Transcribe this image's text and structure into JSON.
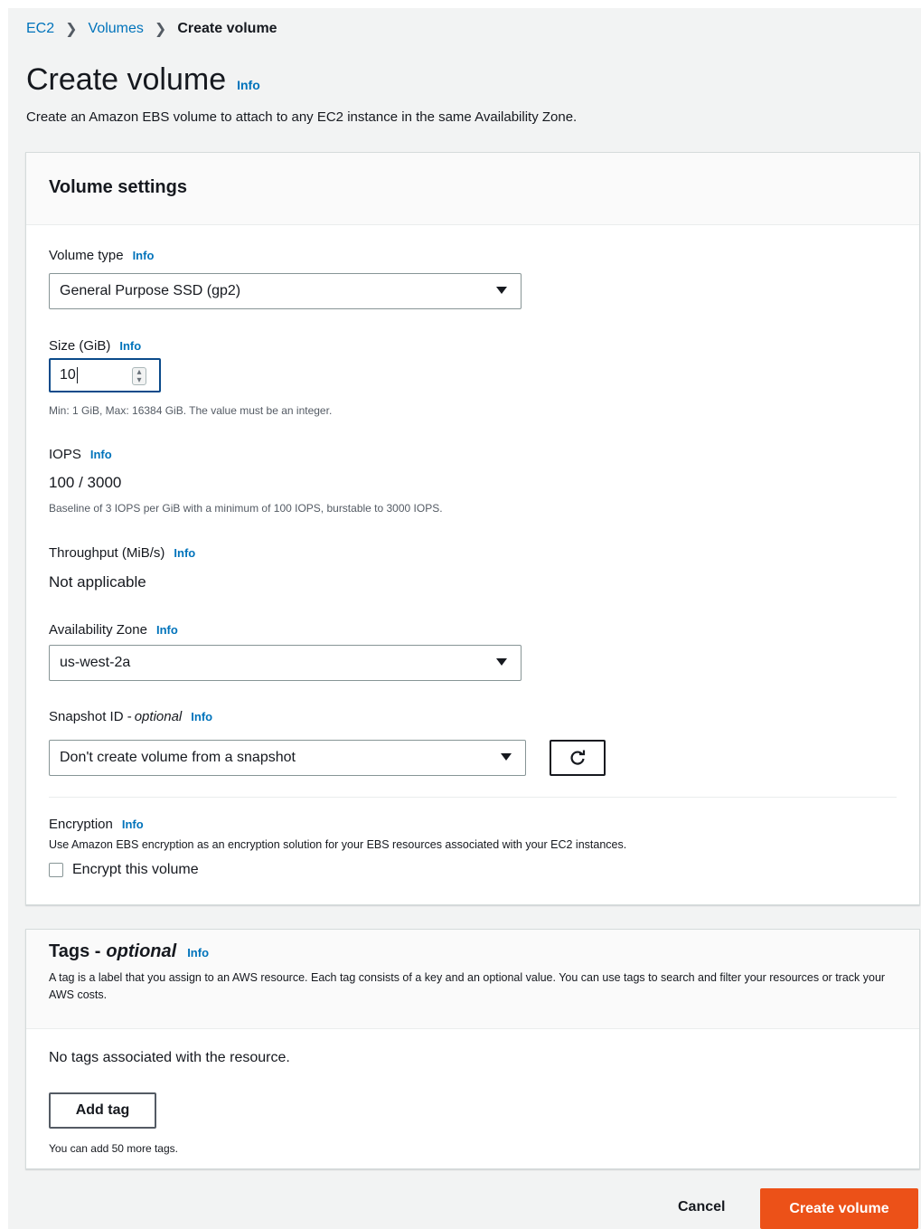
{
  "breadcrumb": {
    "items": [
      "EC2",
      "Volumes",
      "Create volume"
    ]
  },
  "page": {
    "title": "Create volume",
    "info": "Info",
    "description": "Create an Amazon EBS volume to attach to any EC2 instance in the same Availability Zone."
  },
  "volume_settings": {
    "heading": "Volume settings",
    "volume_type": {
      "label": "Volume type",
      "info": "Info",
      "value": "General Purpose SSD (gp2)"
    },
    "size": {
      "label": "Size (GiB)",
      "info": "Info",
      "value": "10",
      "hint": "Min: 1 GiB, Max: 16384 GiB. The value must be an integer."
    },
    "iops": {
      "label": "IOPS",
      "info": "Info",
      "value": "100 / 3000",
      "hint": "Baseline of 3 IOPS per GiB with a minimum of 100 IOPS, burstable to 3000 IOPS."
    },
    "throughput": {
      "label": "Throughput (MiB/s)",
      "info": "Info",
      "value": "Not applicable"
    },
    "availability_zone": {
      "label": "Availability Zone",
      "info": "Info",
      "value": "us-west-2a"
    },
    "snapshot": {
      "label": "Snapshot ID - ",
      "label_optional": "optional",
      "info": "Info",
      "value": "Don't create volume from a snapshot"
    },
    "encryption": {
      "label": "Encryption",
      "info": "Info",
      "hint": "Use Amazon EBS encryption as an encryption solution for your EBS resources associated with your EC2 instances.",
      "checkbox_label": "Encrypt this volume",
      "checked": false
    }
  },
  "tags": {
    "heading": "Tags - ",
    "heading_optional": "optional",
    "info": "Info",
    "description": "A tag is a label that you assign to an AWS resource. Each tag consists of a key and an optional value. You can use tags to search and filter your resources or track your AWS costs.",
    "empty_text": "No tags associated with the resource.",
    "add_button": "Add tag",
    "limit_hint": "You can add 50 more tags."
  },
  "actions": {
    "cancel": "Cancel",
    "create": "Create volume"
  },
  "colors": {
    "primary": "#ec5118",
    "link": "#0073bb",
    "focus": "#0a4a8a"
  }
}
